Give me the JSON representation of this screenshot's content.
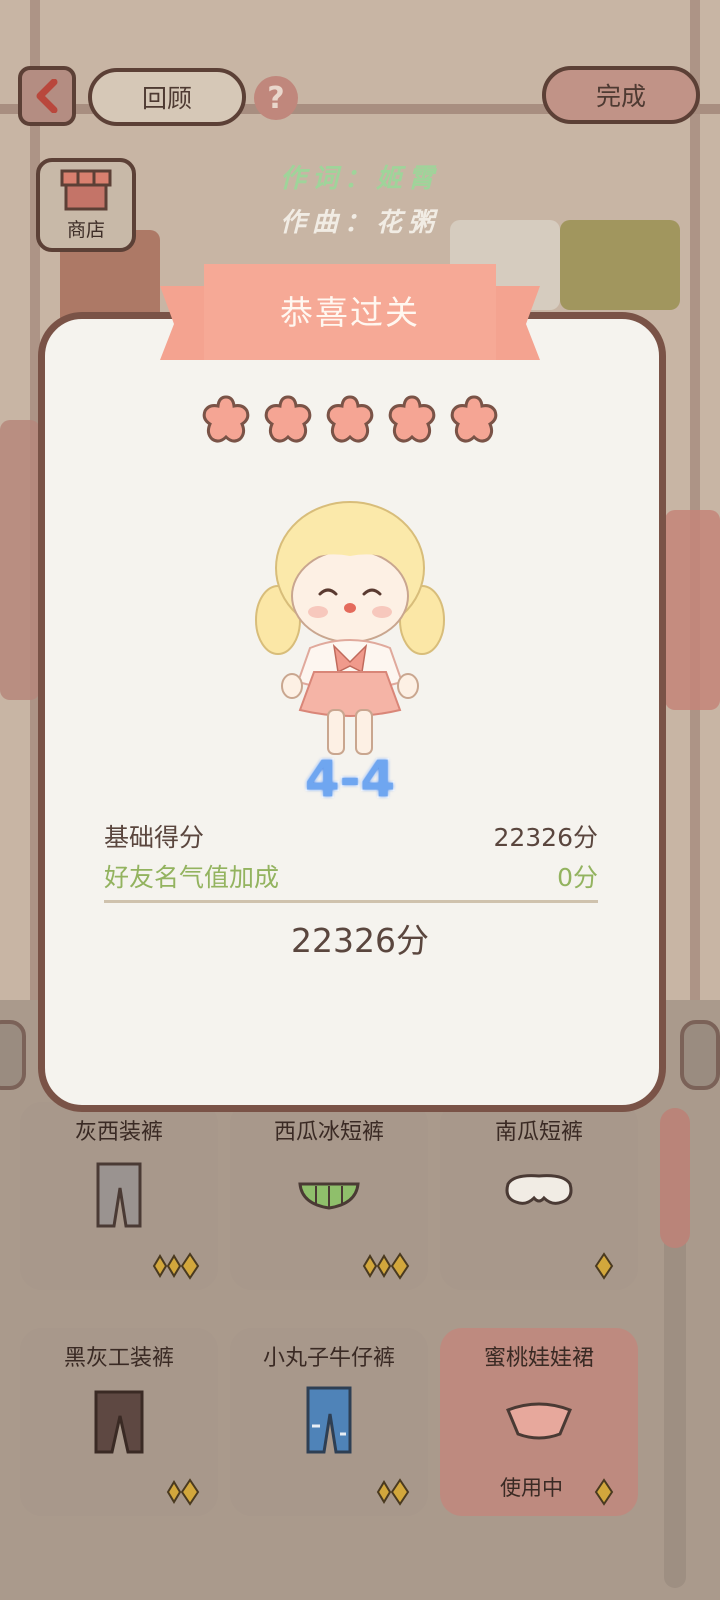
{
  "header": {
    "back_label": "",
    "review_label": "回顾",
    "done_label": "完成",
    "shop_label": "商店"
  },
  "credits": {
    "lyric": "作词：姬霄",
    "music": "作曲：花粥"
  },
  "result": {
    "title": "恭喜过关",
    "stars_earned": 5,
    "stars_total": 5,
    "level": "4-4",
    "base_label": "基础得分",
    "base_value": "22326分",
    "friend_label": "好友名气值加成",
    "friend_value": "0分",
    "total_value": "22326分"
  },
  "wardrobe": {
    "items": [
      {
        "name": "灰西装裤",
        "rank_stars": 3,
        "status": ""
      },
      {
        "name": "西瓜冰短裤",
        "rank_stars": 3,
        "status": ""
      },
      {
        "name": "南瓜短裤",
        "rank_stars": 1,
        "status": ""
      },
      {
        "name": "黑灰工装裤",
        "rank_stars": 2,
        "status": ""
      },
      {
        "name": "小丸子牛仔裤",
        "rank_stars": 2,
        "status": ""
      },
      {
        "name": "蜜桃娃娃裙",
        "rank_stars": 1,
        "status": "使用中"
      }
    ]
  },
  "colors": {
    "accent": "#f4a390",
    "modal_border": "#7a5347",
    "level_blue": "#6fa6f0",
    "bonus_green": "#93b35f"
  }
}
